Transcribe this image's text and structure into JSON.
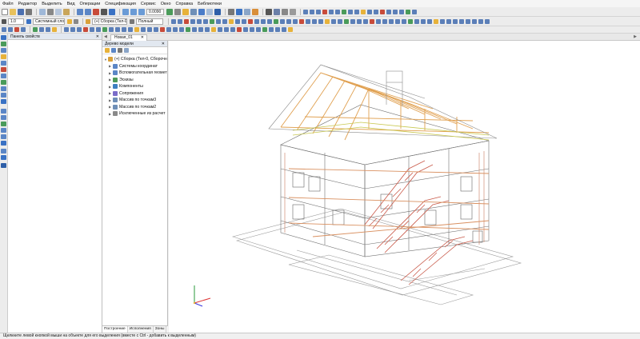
{
  "menu": [
    "Файл",
    "Редактор",
    "Выделить",
    "Вид",
    "Операции",
    "Спецификация",
    "Сервис",
    "Окно",
    "Справка",
    "Библиотеки"
  ],
  "toolbar": {
    "zoom_value": "0.0090",
    "line_width": "1.0",
    "layer": "Системный слой (0)",
    "assembly": "(+) Сборка (Тел-0, 0",
    "view_mode": "Полный"
  },
  "props_panel": {
    "title": "Панель свойств"
  },
  "doc_tab": {
    "label": "Новая_01"
  },
  "tree_panel": {
    "title": "Дерево модели",
    "items": [
      {
        "label": "(+) Сборка (Тел-0, Сборочны",
        "color": "#d9a13a",
        "level": 0
      },
      {
        "label": "Системы координат",
        "color": "#5b86c6",
        "level": 1
      },
      {
        "label": "Вспомогательная геомет",
        "color": "#5b86c6",
        "level": 1
      },
      {
        "label": "Эскизы",
        "color": "#4e9a59",
        "level": 1
      },
      {
        "label": "Компоненты",
        "color": "#3e7fc1",
        "level": 1
      },
      {
        "label": "Сопряжения",
        "color": "#7a6cc9",
        "level": 1
      },
      {
        "label": "Массив по точкам3",
        "color": "#6f8fb7",
        "level": 1
      },
      {
        "label": "Массив по точкам2",
        "color": "#6f8fb7",
        "level": 1
      },
      {
        "label": "Исключенные из расчет",
        "color": "#8a8a8a",
        "level": 1
      }
    ],
    "tabs": [
      "Построение",
      "Исполнения",
      "Зоны"
    ]
  },
  "status": {
    "text": "Щелкните левой кнопкой мыши на объекте для его выделения (вместе с Ctrl - добавить к выделенным)"
  },
  "colors": {
    "accent": "#3a72c4",
    "beam": "#e0a050",
    "stair": "#c95a4a"
  }
}
